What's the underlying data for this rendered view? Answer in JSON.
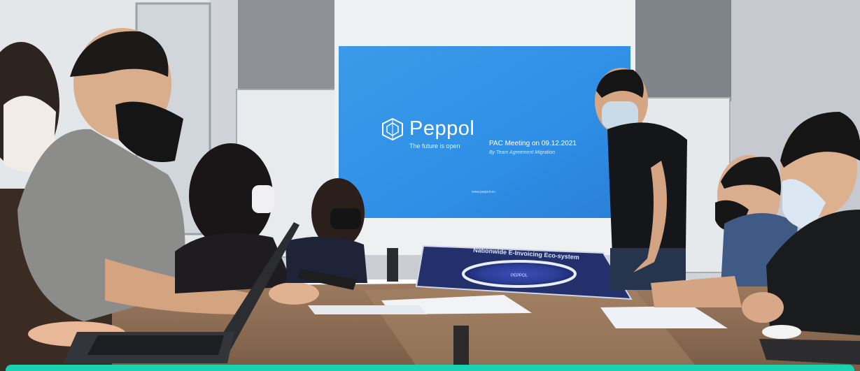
{
  "slide": {
    "brand": "Peppol",
    "tagline": "The future is open",
    "meeting": "PAC Meeting on 09.12.2021",
    "subtitle": "By Team Agreement Migration",
    "url": "www.peppol.eu"
  },
  "poster": {
    "title": "Nationwide E-Invoicing Eco-system",
    "center_label": "PEPPOL"
  },
  "colors": {
    "accent_bar": "#18d2b0",
    "slide_blue": "#2f8fe6",
    "table_wood": "#8a6b52"
  }
}
